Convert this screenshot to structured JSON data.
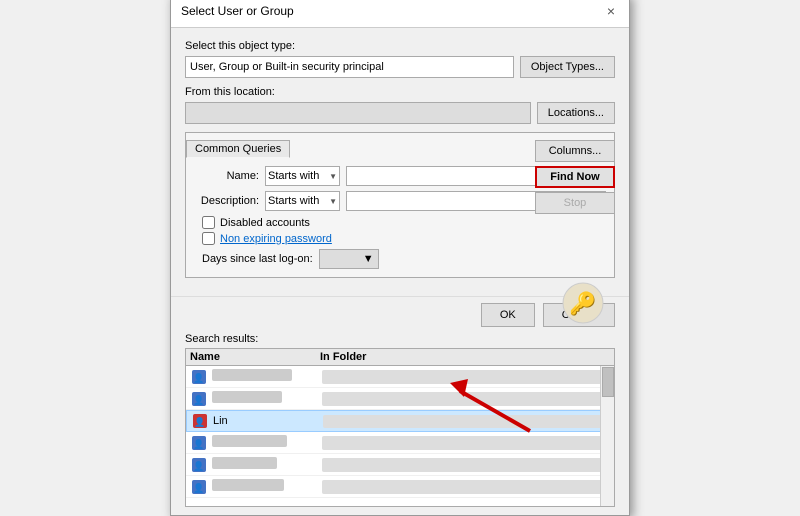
{
  "dialog": {
    "title": "Select User or Group",
    "close_label": "×",
    "object_type_label": "Select this object type:",
    "object_type_value": "User, Group or Built-in security principal",
    "object_types_btn": "Object Types...",
    "location_label": "From this location:",
    "location_value": "",
    "locations_btn": "Locations...",
    "common_queries_tab": "Common Queries",
    "name_label": "Name:",
    "description_label": "Description:",
    "starts_with": "Starts with",
    "disabled_accounts_label": "Disabled accounts",
    "non_expiring_label": "Non expiring password",
    "days_label": "Days since last log-on:",
    "columns_btn": "Columns...",
    "find_now_btn": "Find Now",
    "stop_btn": "Stop",
    "ok_btn": "OK",
    "cancel_btn": "Cancel",
    "search_results_label": "Search results:",
    "col_name": "Name",
    "col_folder": "In Folder",
    "rows": [
      {
        "name": "",
        "folder": "",
        "selected": false
      },
      {
        "name": "",
        "folder": "",
        "selected": false
      },
      {
        "name": "Lin",
        "folder": "",
        "selected": true
      },
      {
        "name": "",
        "folder": "",
        "selected": false
      },
      {
        "name": "",
        "folder": "",
        "selected": false
      },
      {
        "name": "",
        "folder": "",
        "selected": false
      }
    ]
  }
}
